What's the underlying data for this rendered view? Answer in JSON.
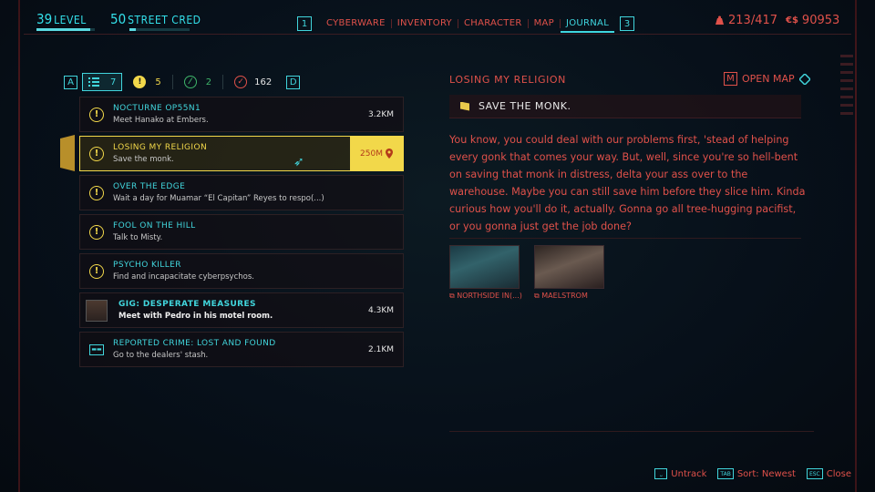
{
  "player": {
    "level": "39",
    "level_label": "LEVEL",
    "level_progress": 0.92,
    "street_cred": "50",
    "street_cred_label": "STREET CRED",
    "street_cred_progress": 0.1
  },
  "nav": {
    "left_key": "1",
    "tabs": [
      {
        "label": "CYBERWARE"
      },
      {
        "label": "INVENTORY"
      },
      {
        "label": "CHARACTER"
      },
      {
        "label": "MAP"
      },
      {
        "label": "JOURNAL",
        "active": true
      }
    ],
    "right_key": "3"
  },
  "status": {
    "carry_weight": "213/417",
    "eddies_symbol": "€$",
    "money": "90953"
  },
  "filters": {
    "left_key": "A",
    "chips": [
      {
        "icon": "list-icon",
        "count": "7",
        "active": true
      },
      {
        "icon": "warning-icon",
        "count": "5"
      },
      {
        "icon": "leaf-icon",
        "count": "2"
      },
      {
        "icon": "check-icon",
        "count": "162"
      }
    ],
    "right_key": "D"
  },
  "quests": [
    {
      "title": "NOCTURNE OP55N1",
      "subtitle": "Meet Hanako at Embers.",
      "distance": "3.2KM",
      "icon": "warning-icon"
    },
    {
      "title": "LOSING MY RELIGION",
      "subtitle": "Save the monk.",
      "distance": "250M",
      "icon": "warning-icon",
      "selected": true
    },
    {
      "title": "OVER THE EDGE",
      "subtitle": "Wait a day for Muamar “El Capitan” Reyes to respo(...)",
      "distance": "",
      "icon": "warning-icon"
    },
    {
      "title": "FOOL ON THE HILL",
      "subtitle": "Talk to Misty.",
      "distance": "",
      "icon": "warning-icon"
    },
    {
      "title": "PSYCHO KILLER",
      "subtitle": "Find and incapacitate cyberpsychos.",
      "distance": "",
      "icon": "warning-icon"
    },
    {
      "title": "GIG: DESPERATE MEASURES",
      "subtitle": "Meet with Pedro in his motel room.",
      "distance": "4.3KM",
      "icon": "avatar"
    },
    {
      "title": "REPORTED CRIME: LOST AND FOUND",
      "subtitle": "Go to the dealers' stash.",
      "distance": "2.1KM",
      "icon": "crime-icon"
    }
  ],
  "detail": {
    "title": "LOSING MY RELIGION",
    "open_map_key": "M",
    "open_map_label": "OPEN MAP",
    "objective": "SAVE THE MONK.",
    "description": "You know, you could deal with our problems first, 'stead of helping every gonk that comes your way. But, well, since you're so hell-bent on saving that monk in distress, delta your ass over to the warehouse. Maybe you can still save him before they slice him. Kinda curious how you'll do it, actually. Gonna go all tree-hugging pacifist, or you gonna just get the job done?",
    "codex": [
      {
        "label": "NORTHSIDE IN(...)"
      },
      {
        "label": "MAELSTROM"
      }
    ]
  },
  "footer": [
    {
      "key": "⎵",
      "label": "Untrack"
    },
    {
      "key": "TAB",
      "label": "Sort: Newest"
    },
    {
      "key": "ESC",
      "label": "Close"
    }
  ],
  "colors": {
    "accent_red": "#e0514a",
    "accent_cyan": "#41d5dc",
    "accent_yellow": "#f2d84a"
  }
}
